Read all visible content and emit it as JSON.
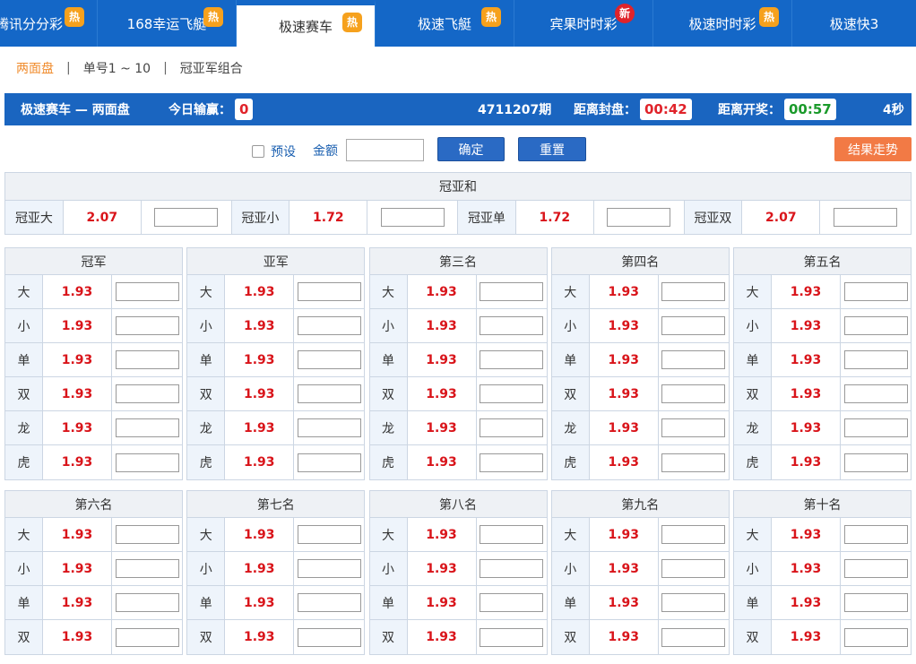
{
  "tabs": [
    {
      "label": "腾讯分分彩",
      "badge": "热",
      "badge_type": "hot",
      "active": false
    },
    {
      "label": "168幸运飞艇",
      "badge": "热",
      "badge_type": "hot",
      "active": false
    },
    {
      "label": "极速赛车",
      "badge": "热",
      "badge_type": "hot",
      "active": true
    },
    {
      "label": "极速飞艇",
      "badge": "热",
      "badge_type": "hot",
      "active": false
    },
    {
      "label": "宾果时时彩",
      "badge": "新",
      "badge_type": "new",
      "active": false
    },
    {
      "label": "极速时时彩",
      "badge": "热",
      "badge_type": "hot",
      "active": false
    },
    {
      "label": "极速快3",
      "badge": "",
      "badge_type": "",
      "active": false
    }
  ],
  "subnav": [
    {
      "label": "两面盘",
      "active": true
    },
    {
      "label": "单号1 ~ 10",
      "active": false
    },
    {
      "label": "冠亚军组合",
      "active": false
    }
  ],
  "infobar": {
    "lottery": "极速赛车 — 两面盘",
    "win_label": "今日输赢：",
    "win_value": "0",
    "period": "4711207期",
    "close_label": "距离封盘：",
    "close_time": "00:42",
    "open_label": "距离开奖：",
    "open_time": "00:57",
    "seconds": "4秒"
  },
  "controls": {
    "preset_label": "预设",
    "amount_label": "金额",
    "confirm": "确定",
    "reset": "重置",
    "trend": "结果走势"
  },
  "sum": {
    "title": "冠亚和",
    "items": [
      {
        "label": "冠亚大",
        "odds": "2.07"
      },
      {
        "label": "冠亚小",
        "odds": "1.72"
      },
      {
        "label": "冠亚单",
        "odds": "1.72"
      },
      {
        "label": "冠亚双",
        "odds": "2.07"
      }
    ]
  },
  "positions_top": [
    {
      "title": "冠军",
      "rows": [
        {
          "label": "大",
          "odds": "1.93"
        },
        {
          "label": "小",
          "odds": "1.93"
        },
        {
          "label": "单",
          "odds": "1.93"
        },
        {
          "label": "双",
          "odds": "1.93"
        },
        {
          "label": "龙",
          "odds": "1.93"
        },
        {
          "label": "虎",
          "odds": "1.93"
        }
      ]
    },
    {
      "title": "亚军",
      "rows": [
        {
          "label": "大",
          "odds": "1.93"
        },
        {
          "label": "小",
          "odds": "1.93"
        },
        {
          "label": "单",
          "odds": "1.93"
        },
        {
          "label": "双",
          "odds": "1.93"
        },
        {
          "label": "龙",
          "odds": "1.93"
        },
        {
          "label": "虎",
          "odds": "1.93"
        }
      ]
    },
    {
      "title": "第三名",
      "rows": [
        {
          "label": "大",
          "odds": "1.93"
        },
        {
          "label": "小",
          "odds": "1.93"
        },
        {
          "label": "单",
          "odds": "1.93"
        },
        {
          "label": "双",
          "odds": "1.93"
        },
        {
          "label": "龙",
          "odds": "1.93"
        },
        {
          "label": "虎",
          "odds": "1.93"
        }
      ]
    },
    {
      "title": "第四名",
      "rows": [
        {
          "label": "大",
          "odds": "1.93"
        },
        {
          "label": "小",
          "odds": "1.93"
        },
        {
          "label": "单",
          "odds": "1.93"
        },
        {
          "label": "双",
          "odds": "1.93"
        },
        {
          "label": "龙",
          "odds": "1.93"
        },
        {
          "label": "虎",
          "odds": "1.93"
        }
      ]
    },
    {
      "title": "第五名",
      "rows": [
        {
          "label": "大",
          "odds": "1.93"
        },
        {
          "label": "小",
          "odds": "1.93"
        },
        {
          "label": "单",
          "odds": "1.93"
        },
        {
          "label": "双",
          "odds": "1.93"
        },
        {
          "label": "龙",
          "odds": "1.93"
        },
        {
          "label": "虎",
          "odds": "1.93"
        }
      ]
    }
  ],
  "positions_bottom": [
    {
      "title": "第六名",
      "rows": [
        {
          "label": "大",
          "odds": "1.93"
        },
        {
          "label": "小",
          "odds": "1.93"
        },
        {
          "label": "单",
          "odds": "1.93"
        },
        {
          "label": "双",
          "odds": "1.93"
        }
      ]
    },
    {
      "title": "第七名",
      "rows": [
        {
          "label": "大",
          "odds": "1.93"
        },
        {
          "label": "小",
          "odds": "1.93"
        },
        {
          "label": "单",
          "odds": "1.93"
        },
        {
          "label": "双",
          "odds": "1.93"
        }
      ]
    },
    {
      "title": "第八名",
      "rows": [
        {
          "label": "大",
          "odds": "1.93"
        },
        {
          "label": "小",
          "odds": "1.93"
        },
        {
          "label": "单",
          "odds": "1.93"
        },
        {
          "label": "双",
          "odds": "1.93"
        }
      ]
    },
    {
      "title": "第九名",
      "rows": [
        {
          "label": "大",
          "odds": "1.93"
        },
        {
          "label": "小",
          "odds": "1.93"
        },
        {
          "label": "单",
          "odds": "1.93"
        },
        {
          "label": "双",
          "odds": "1.93"
        }
      ]
    },
    {
      "title": "第十名",
      "rows": [
        {
          "label": "大",
          "odds": "1.93"
        },
        {
          "label": "小",
          "odds": "1.93"
        },
        {
          "label": "单",
          "odds": "1.93"
        },
        {
          "label": "双",
          "odds": "1.93"
        }
      ]
    }
  ],
  "colors": {
    "nav_blue": "#1467c7",
    "odds_red": "#d9141a",
    "hot_badge": "#f6a11d",
    "new_badge": "#e0232a",
    "trend_orange": "#f27a45",
    "timer_red": "#e0232a",
    "timer_green": "#1a9a2a"
  }
}
